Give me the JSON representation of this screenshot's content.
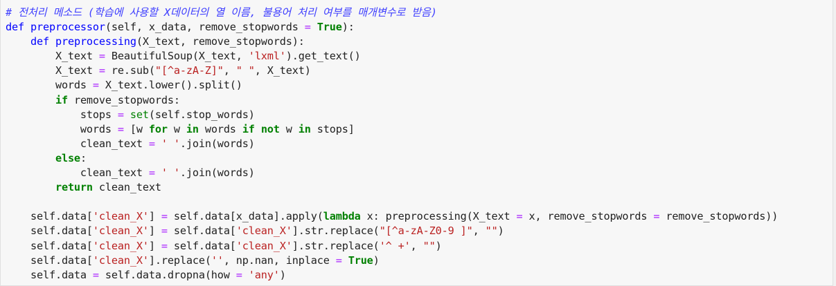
{
  "code_lines": [
    [
      {
        "t": "# 전처리 메소드 (학습에 사용할 X데이터의 열 이름, 불용어 처리 여부를 매개변수로 받음)",
        "c": "cm"
      }
    ],
    [
      {
        "t": "def",
        "c": "kw-def"
      },
      {
        "t": " "
      },
      {
        "t": "preprocessor",
        "c": "fn"
      },
      {
        "t": "(self, x_data, remove_stopwords "
      },
      {
        "t": "=",
        "c": "op"
      },
      {
        "t": " "
      },
      {
        "t": "True",
        "c": "kw"
      },
      {
        "t": "):"
      }
    ],
    [
      {
        "t": "    "
      },
      {
        "t": "def",
        "c": "kw-def"
      },
      {
        "t": " "
      },
      {
        "t": "preprocessing",
        "c": "fn"
      },
      {
        "t": "(X_text, remove_stopwords):"
      }
    ],
    [
      {
        "t": "        X_text "
      },
      {
        "t": "=",
        "c": "op"
      },
      {
        "t": " BeautifulSoup(X_text, "
      },
      {
        "t": "'lxml'",
        "c": "st"
      },
      {
        "t": ").get_text()"
      }
    ],
    [
      {
        "t": "        X_text "
      },
      {
        "t": "=",
        "c": "op"
      },
      {
        "t": " re.sub("
      },
      {
        "t": "\"[^a-zA-Z]\"",
        "c": "st"
      },
      {
        "t": ", "
      },
      {
        "t": "\" \"",
        "c": "st"
      },
      {
        "t": ", X_text)"
      }
    ],
    [
      {
        "t": "        words "
      },
      {
        "t": "=",
        "c": "op"
      },
      {
        "t": " X_text.lower().split()"
      }
    ],
    [
      {
        "t": "        "
      },
      {
        "t": "if",
        "c": "kw"
      },
      {
        "t": " remove_stopwords:"
      }
    ],
    [
      {
        "t": "            stops "
      },
      {
        "t": "=",
        "c": "op"
      },
      {
        "t": " "
      },
      {
        "t": "set",
        "c": "bi"
      },
      {
        "t": "(self.stop_words)"
      }
    ],
    [
      {
        "t": "            words "
      },
      {
        "t": "=",
        "c": "op"
      },
      {
        "t": " [w "
      },
      {
        "t": "for",
        "c": "kw"
      },
      {
        "t": " w "
      },
      {
        "t": "in",
        "c": "kw"
      },
      {
        "t": " words "
      },
      {
        "t": "if",
        "c": "kw"
      },
      {
        "t": " "
      },
      {
        "t": "not",
        "c": "kw"
      },
      {
        "t": " w "
      },
      {
        "t": "in",
        "c": "kw"
      },
      {
        "t": " stops]"
      }
    ],
    [
      {
        "t": "            clean_text "
      },
      {
        "t": "=",
        "c": "op"
      },
      {
        "t": " "
      },
      {
        "t": "' '",
        "c": "st"
      },
      {
        "t": ".join(words)"
      }
    ],
    [
      {
        "t": "        "
      },
      {
        "t": "else",
        "c": "kw"
      },
      {
        "t": ":"
      }
    ],
    [
      {
        "t": "            clean_text "
      },
      {
        "t": "=",
        "c": "op"
      },
      {
        "t": " "
      },
      {
        "t": "' '",
        "c": "st"
      },
      {
        "t": ".join(words)"
      }
    ],
    [
      {
        "t": "        "
      },
      {
        "t": "return",
        "c": "kw"
      },
      {
        "t": " clean_text"
      }
    ],
    [
      {
        "t": ""
      }
    ],
    [
      {
        "t": "    self.data["
      },
      {
        "t": "'clean_X'",
        "c": "st"
      },
      {
        "t": "] "
      },
      {
        "t": "=",
        "c": "op"
      },
      {
        "t": " self.data[x_data].apply("
      },
      {
        "t": "lambda",
        "c": "kw"
      },
      {
        "t": " x: preprocessing(X_text "
      },
      {
        "t": "=",
        "c": "op"
      },
      {
        "t": " x, remove_stopwords "
      },
      {
        "t": "=",
        "c": "op"
      },
      {
        "t": " remove_stopwords))"
      }
    ],
    [
      {
        "t": "    self.data["
      },
      {
        "t": "'clean_X'",
        "c": "st"
      },
      {
        "t": "] "
      },
      {
        "t": "=",
        "c": "op"
      },
      {
        "t": " self.data["
      },
      {
        "t": "'clean_X'",
        "c": "st"
      },
      {
        "t": "].str.replace("
      },
      {
        "t": "\"[^a-zA-Z0-9 ]\"",
        "c": "st"
      },
      {
        "t": ", "
      },
      {
        "t": "\"\"",
        "c": "st"
      },
      {
        "t": ")"
      }
    ],
    [
      {
        "t": "    self.data["
      },
      {
        "t": "'clean_X'",
        "c": "st"
      },
      {
        "t": "] "
      },
      {
        "t": "=",
        "c": "op"
      },
      {
        "t": " self.data["
      },
      {
        "t": "'clean_X'",
        "c": "st"
      },
      {
        "t": "].str.replace("
      },
      {
        "t": "'^ +'",
        "c": "st"
      },
      {
        "t": ", "
      },
      {
        "t": "\"\"",
        "c": "st"
      },
      {
        "t": ")"
      }
    ],
    [
      {
        "t": "    self.data["
      },
      {
        "t": "'clean_X'",
        "c": "st"
      },
      {
        "t": "].replace("
      },
      {
        "t": "''",
        "c": "st"
      },
      {
        "t": ", np.nan, inplace "
      },
      {
        "t": "=",
        "c": "op"
      },
      {
        "t": " "
      },
      {
        "t": "True",
        "c": "kw"
      },
      {
        "t": ")"
      }
    ],
    [
      {
        "t": "    self.data "
      },
      {
        "t": "=",
        "c": "op"
      },
      {
        "t": " self.data.dropna(how "
      },
      {
        "t": "=",
        "c": "op"
      },
      {
        "t": " "
      },
      {
        "t": "'any'",
        "c": "st"
      },
      {
        "t": ")"
      }
    ]
  ]
}
